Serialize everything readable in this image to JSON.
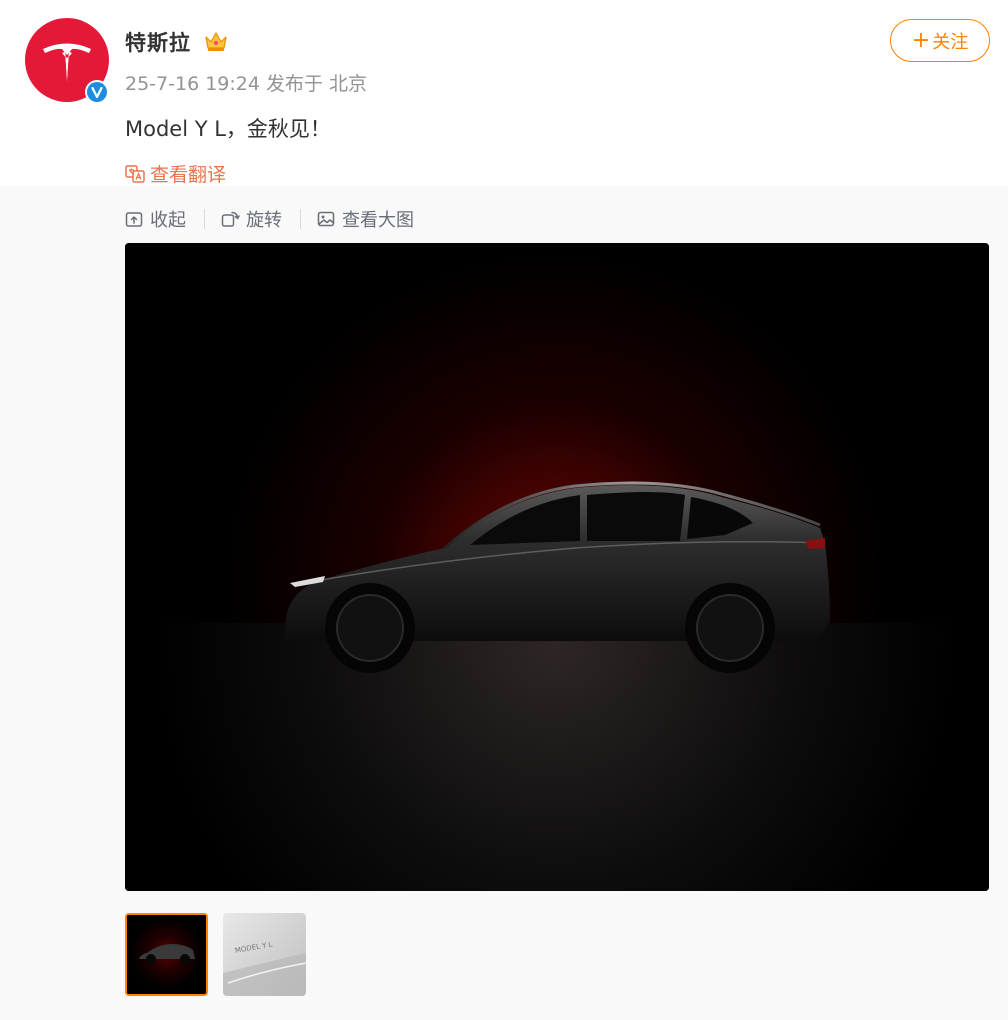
{
  "post": {
    "author": {
      "name": "特斯拉",
      "avatar_icon": "tesla-logo-icon",
      "badge_icon": "verified-icon",
      "vip_icon": "crown-icon"
    },
    "meta": "25-7-16 19:24 发布于 北京",
    "follow_label": "关注",
    "text": "Model Y L，金秋见！",
    "translate_label": "查看翻译"
  },
  "toolbar": {
    "collapse_label": "收起",
    "rotate_label": "旋转",
    "view_large_label": "查看大图"
  },
  "thumbnail_text": "MODEL Y L",
  "colors": {
    "brand_red": "#e31937",
    "follow_orange": "#ff8200",
    "translate_orange": "#eb7350",
    "verified_blue": "#1d8de0"
  }
}
